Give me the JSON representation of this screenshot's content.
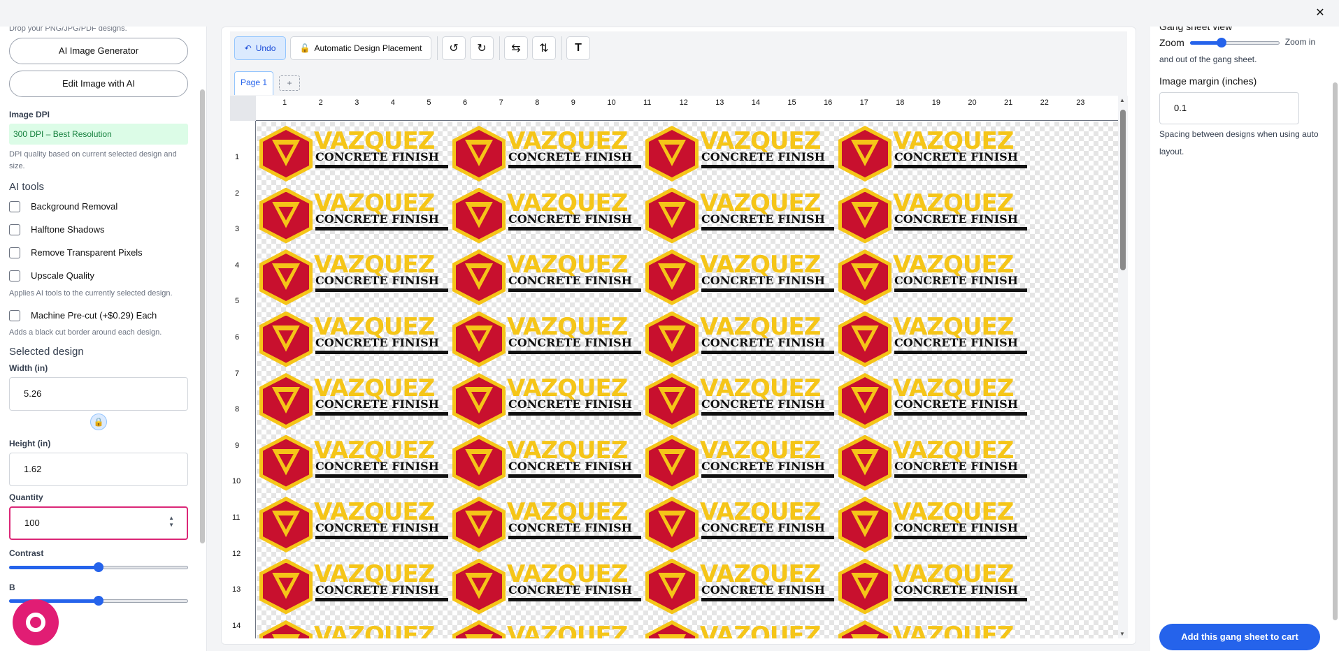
{
  "window": {
    "close_glyph": "✕"
  },
  "left_panel": {
    "drop_hint": "Drop your PNG/JPG/PDF designs.",
    "ai_image_generator": "AI Image Generator",
    "edit_image_ai": "Edit Image with AI",
    "image_dpi_label": "Image DPI",
    "dpi_value": "300 DPI – Best Resolution",
    "dpi_help": "DPI quality based on current selected design and size.",
    "ai_tools_heading": "AI tools",
    "ai_tools": [
      {
        "label": "Background Removal",
        "checked": false
      },
      {
        "label": "Halftone Shadows",
        "checked": false
      },
      {
        "label": "Remove Transparent Pixels",
        "checked": false
      },
      {
        "label": "Upscale Quality",
        "checked": false
      }
    ],
    "ai_tools_help": "Applies AI tools to the currently selected design.",
    "precut_label": "Machine Pre-cut (+$0.29) Each",
    "precut_help": "Adds a black cut border around each design.",
    "selected_design_heading": "Selected design",
    "width_label": "Width (in)",
    "width_value": "5.26",
    "height_label": "Height (in)",
    "height_value": "1.62",
    "quantity_label": "Quantity",
    "quantity_value": "100",
    "contrast_label": "Contrast",
    "contrast_level": 0.5,
    "brightness_label": "B",
    "brightness_level": 0.5
  },
  "toolbar": {
    "undo": "Undo",
    "auto_placement": "Automatic Design Placement",
    "icons": [
      "rotate-left-icon",
      "rotate-right-icon",
      "flip-horizontal-icon",
      "flip-vertical-icon",
      "text-icon"
    ]
  },
  "tabs": {
    "page1": "Page 1",
    "add": "+"
  },
  "ruler": {
    "top": [
      "1",
      "2",
      "3",
      "4",
      "5",
      "6",
      "7",
      "8",
      "9",
      "10",
      "11",
      "12",
      "13",
      "14",
      "15",
      "16",
      "17",
      "18",
      "19",
      "20",
      "21",
      "22",
      "23"
    ],
    "left": [
      "1",
      "2",
      "3",
      "4",
      "5",
      "6",
      "7",
      "8",
      "9",
      "10",
      "11",
      "12",
      "13",
      "14"
    ]
  },
  "design": {
    "word": "VAZQUEZ",
    "subtitle": "CONCRETE FINISH",
    "colors": {
      "gold": "#f5c518",
      "red": "#c8102e",
      "black": "#111111"
    }
  },
  "right_panel": {
    "gang_sheet_view": "Gang sheet view",
    "zoom_label": "Zoom",
    "zoom_level": 0.35,
    "zoom_help_inline": "Zoom in",
    "zoom_help_rest": "and out of the gang sheet.",
    "margin_label": "Image margin (inches)",
    "margin_value": "0.1",
    "margin_help": "Spacing between designs when using auto layout.",
    "add_to_cart": "Add this gang sheet to cart"
  }
}
